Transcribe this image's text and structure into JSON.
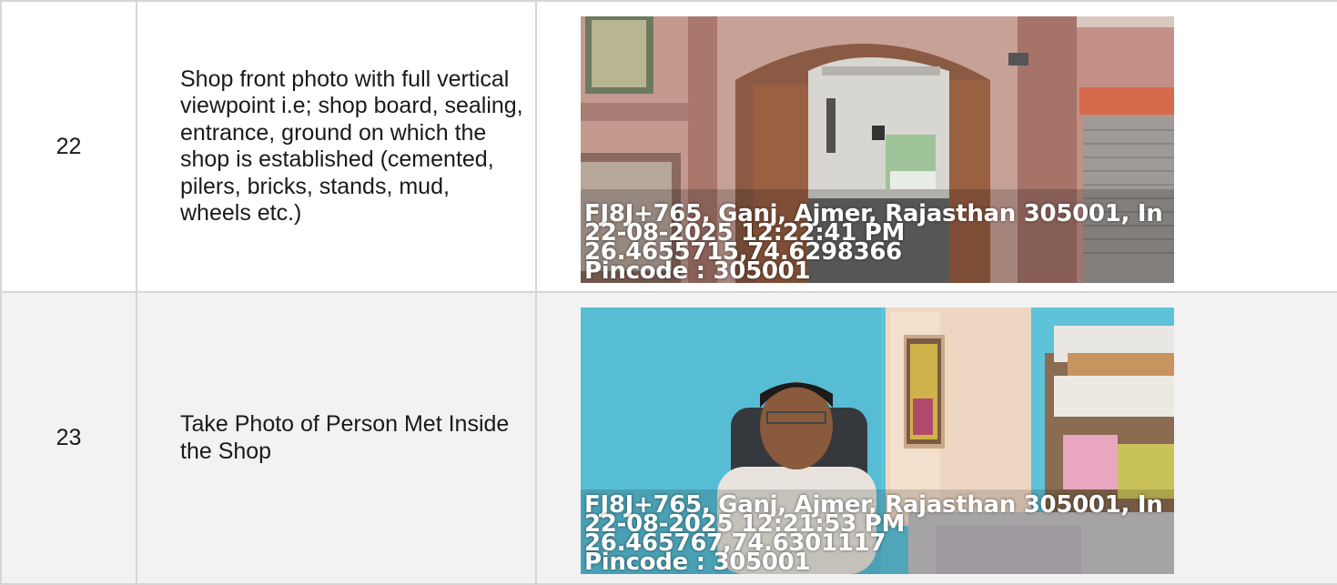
{
  "rows": [
    {
      "number": "22",
      "description": "Shop front photo with full vertical viewpoint i.e; shop board, sealing, entrance, ground on which the shop is established (cemented, pilers, bricks, stands, mud, wheels etc.)",
      "photo_overlay": {
        "address": "FJ8J+765, Ganj, Ajmer, Rajasthan 305001, In",
        "datetime": "22-08-2025 12:22:41 PM",
        "coordinates": "26.4655715,74.6298366",
        "pincode": "Pincode : 305001"
      }
    },
    {
      "number": "23",
      "description": "Take Photo of Person Met Inside the Shop",
      "photo_overlay": {
        "address": "FJ8J+765, Ganj, Ajmer, Rajasthan 305001, In",
        "datetime": "22-08-2025 12:21:53 PM",
        "coordinates": "26.465767,74.6301117",
        "pincode": "Pincode : 305001"
      }
    }
  ],
  "colors": {
    "border": "#d6d6d6",
    "alt_row_bg": "#f2f2f2",
    "wall_pink": "#c89a8f",
    "wall_blue": "#5fc6dc"
  }
}
